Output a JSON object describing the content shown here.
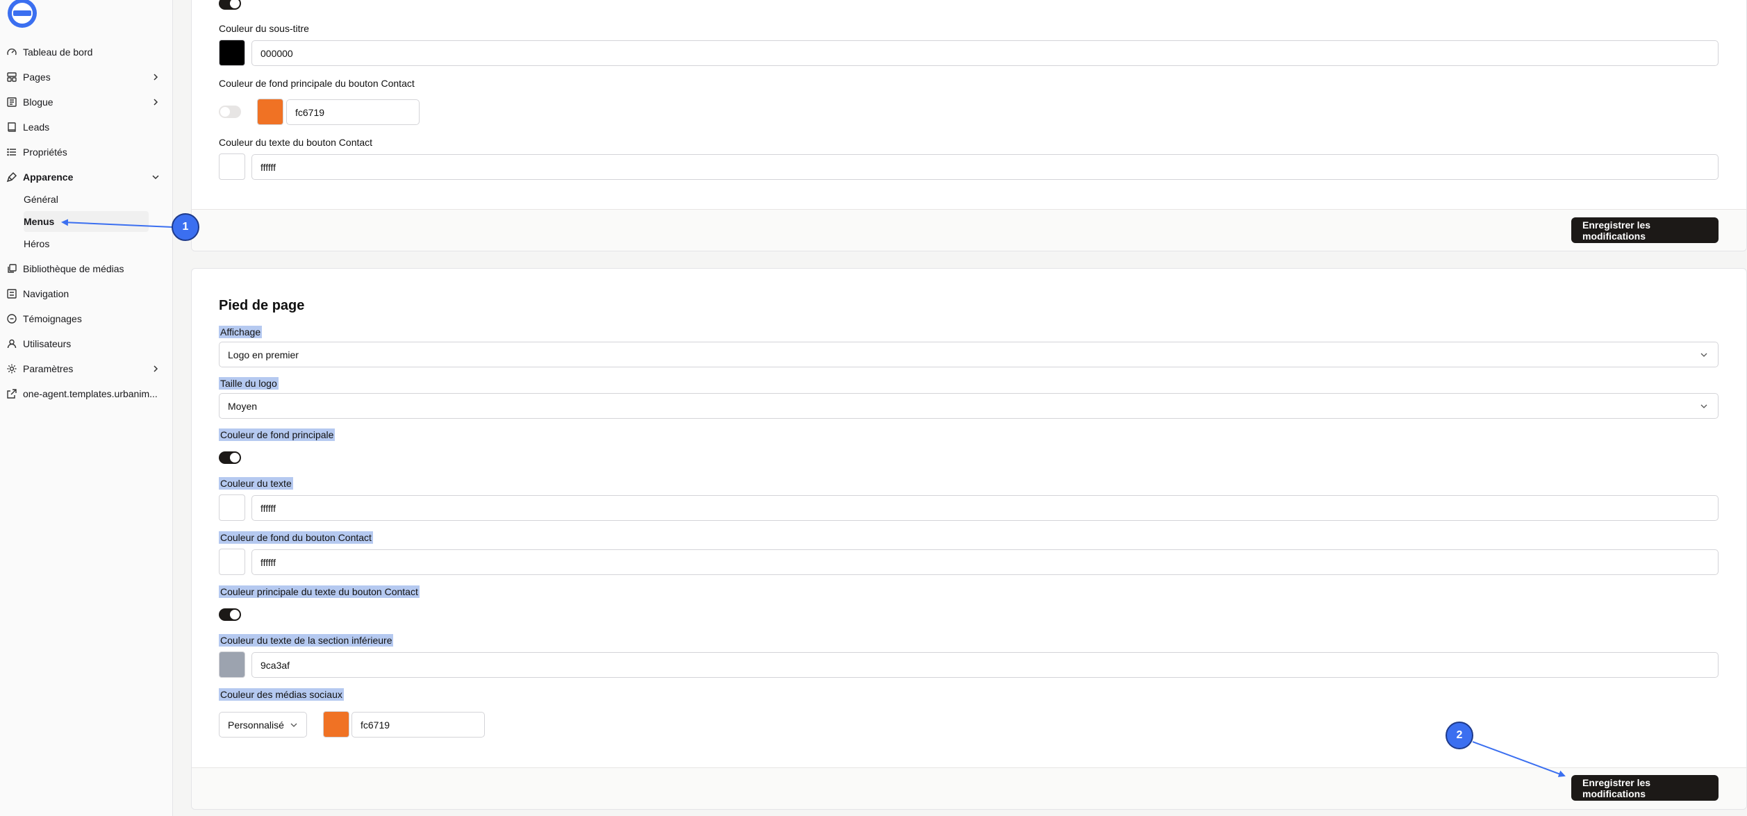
{
  "sidebar": {
    "items": [
      {
        "label": "Tableau de bord",
        "icon": "gauge-icon"
      },
      {
        "label": "Pages",
        "icon": "layout-icon"
      },
      {
        "label": "Blogue",
        "icon": "newspaper-icon"
      },
      {
        "label": "Leads",
        "icon": "book-icon"
      },
      {
        "label": "Propriétés",
        "icon": "list-icon"
      },
      {
        "label": "Apparence",
        "icon": "brush-icon"
      },
      {
        "label": "Bibliothèque de médias",
        "icon": "media-library-icon"
      },
      {
        "label": "Navigation",
        "icon": "navigation-icon"
      },
      {
        "label": "Témoignages",
        "icon": "message-icon"
      },
      {
        "label": "Utilisateurs",
        "icon": "user-icon"
      },
      {
        "label": "Paramètres",
        "icon": "settings-icon"
      },
      {
        "label": "one-agent.templates.urbanim...",
        "icon": "external-link-icon"
      }
    ],
    "appearance_sub": [
      {
        "label": "Général"
      },
      {
        "label": "Menus"
      },
      {
        "label": "Héros"
      }
    ]
  },
  "header_section": {
    "subtitle_color_label": "Couleur du sous-titre",
    "subtitle_color_value": "000000",
    "contact_bg_label": "Couleur de fond principale du bouton Contact",
    "contact_bg_value": "fc6719",
    "contact_text_label": "Couleur du texte du bouton Contact",
    "contact_text_value": "ffffff",
    "save_label": "Enregistrer les modifications"
  },
  "footer_section": {
    "title": "Pied de page",
    "display_label": "Affichage",
    "display_value": "Logo en premier",
    "logo_size_label": "Taille du logo",
    "logo_size_value": "Moyen",
    "main_bg_label": "Couleur de fond principale",
    "text_color_label": "Couleur du texte",
    "text_color_value": "ffffff",
    "contact_bg_label": "Couleur de fond du bouton Contact",
    "contact_bg_value": "ffffff",
    "contact_text_label": "Couleur principale du texte du bouton Contact",
    "bottom_text_label": "Couleur du texte de la section inférieure",
    "bottom_text_value": "9ca3af",
    "social_label": "Couleur des médias sociaux",
    "social_mode": "Personnalisé",
    "social_value": "fc6719",
    "save_label": "Enregistrer les modifications"
  },
  "annotations": {
    "badge1": "1",
    "badge2": "2"
  },
  "colors": {
    "black": "#000000",
    "orange": "#f07224",
    "white": "#ffffff",
    "gray": "#9ca3af",
    "accent": "#3b6ff0"
  }
}
